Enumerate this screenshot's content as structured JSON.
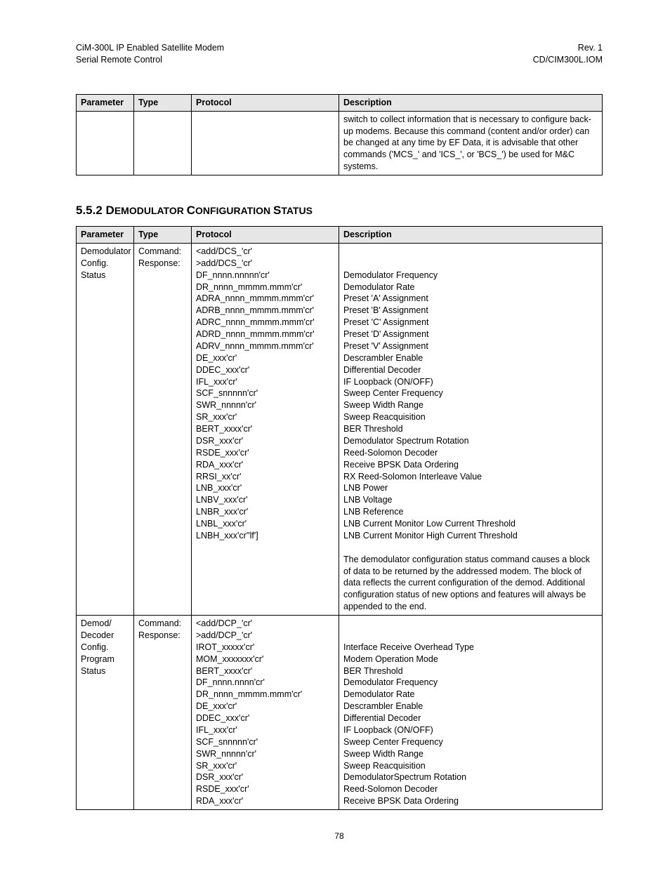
{
  "header": {
    "left_line1": "CiM-300L IP Enabled Satellite Modem",
    "left_line2": "Serial Remote Control",
    "right_line1": "Rev. 1",
    "right_line2": "CD/CIM300L.IOM"
  },
  "table1": {
    "headers": {
      "p": "Parameter",
      "t": "Type",
      "pr": "Protocol",
      "d": "Description"
    },
    "row": {
      "parameter": "",
      "type": "",
      "protocol": "",
      "description": "switch to collect information that is necessary to configure back-up modems. Because this command (content and/or order) can be changed at any time by EF Data, it is advisable that other commands ('MCS_' and 'ICS_', or 'BCS_') be used for M&C systems."
    }
  },
  "section_heading": {
    "num": "5.5.2 ",
    "word1_first": "D",
    "word1_rest": "EMODULATOR ",
    "word2_first": "C",
    "word2_rest": "ONFIGURATION ",
    "word3_first": "S",
    "word3_rest": "TATUS"
  },
  "table2": {
    "headers": {
      "p": "Parameter",
      "t": "Type",
      "pr": "Protocol",
      "d": "Description"
    },
    "rows": [
      {
        "parameter": "Demodulator\nConfig.\nStatus",
        "type": "Command:\nResponse:",
        "protocol": "<add/DCS_'cr'\n>add/DCS_'cr'\nDF_nnnn.nnnnn'cr'\nDR_nnnn_mmmm.mmm'cr'\nADRA_nnnn_mmmm.mmm'cr'\nADRB_nnnn_mmmm.mmm'cr'\nADRC_nnnn_mmmm.mmm'cr'\nADRD_nnnn_mmmm.mmm'cr'\nADRV_nnnn_mmmm.mmm'cr'\nDE_xxx'cr'\nDDEC_xxx'cr'\nIFL_xxx'cr'\nSCF_snnnnn'cr'\nSWR_nnnnn'cr'\nSR_xxx'cr'\nBERT_xxxx'cr'\nDSR_xxx'cr'\nRSDE_xxx'cr'\nRDA_xxx'cr'\nRRSI_xx'cr'\nLNB_xxx'cr'\nLNBV_xxx'cr'\nLNBR_xxx'cr'\nLNBL_xxx'cr'\nLNBH_xxx'cr''lf']",
        "description": "\n\nDemodulator Frequency\nDemodulator Rate\nPreset 'A' Assignment\nPreset 'B' Assignment\nPreset 'C' Assignment\nPreset 'D' Assignment\nPreset 'V' Assignment\nDescrambler Enable\nDifferential Decoder\nIF Loopback (ON/OFF)\nSweep Center Frequency\nSweep Width Range\nSweep Reacquisition\nBER Threshold\nDemodulator  Spectrum Rotation\nReed-Solomon Decoder\nReceive BPSK Data Ordering\nRX Reed-Solomon Interleave Value\nLNB Power\nLNB Voltage\nLNB Reference\nLNB Current  Monitor Low Current Threshold\nLNB Current  Monitor High Current  Threshold\n\nThe demodulator configuration status command causes a block of data to be returned by the addressed modem. The block of data reflects the current configuration of the demod. Additional configuration status of new options and features will always be appended to the end."
      },
      {
        "parameter": "Demod/\nDecoder\nConfig.\nProgram\nStatus",
        "type": "Command:\nResponse:",
        "protocol": "<add/DCP_'cr'\n>add/DCP_'cr'\nIROT_xxxxx'cr'\nMOM_xxxxxxx'cr'\nBERT_xxxx'cr'\nDF_nnnn.nnnn'cr'\nDR_nnnn_mmmm.mmm'cr'\nDE_xxx'cr'\nDDEC_xxx'cr'\nIFL_xxx'cr'\nSCF_snnnnn'cr'\nSWR_nnnnn'cr'\nSR_xxx'cr'\nDSR_xxx'cr'\nRSDE_xxx'cr'\nRDA_xxx'cr'",
        "description": "\n\nInterface Receive Overhead Type\nModem Operation Mode\nBER Threshold\nDemodulator Frequency\nDemodulator Rate\nDescrambler Enable\nDifferential Decoder\nIF Loopback (ON/OFF)\nSweep Center Frequency\nSweep Width Range\nSweep Reacquisition\nDemodulatorSpectrum Rotation\nReed-Solomon Decoder\nReceive BPSK Data Ordering"
      }
    ]
  },
  "page_number": "78"
}
